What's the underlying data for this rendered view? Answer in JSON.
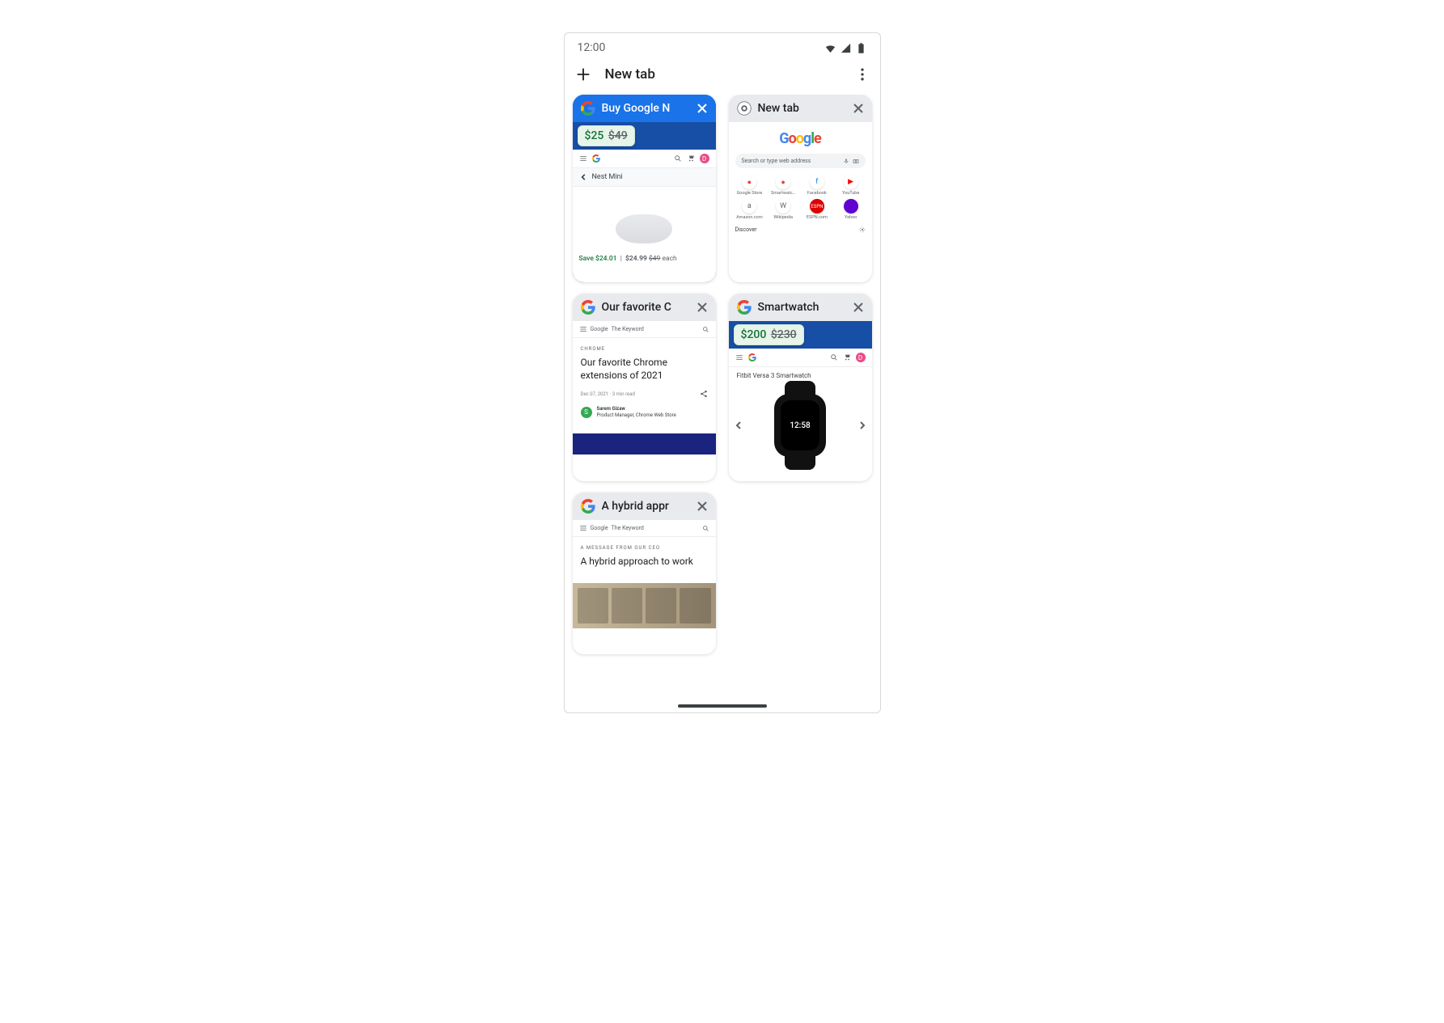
{
  "status": {
    "time": "12:00"
  },
  "toolbar": {
    "new_tab_label": "New tab"
  },
  "tabs": [
    {
      "title": "Buy Google N",
      "selected": true,
      "favicon": "google",
      "price_chip": {
        "current": "$25",
        "old": "$49"
      },
      "store": {
        "back_label": "Nest Mini",
        "save_text": "Save $24.01",
        "price_text": "$24.99",
        "old_price": "$49",
        "suffix": "each"
      }
    },
    {
      "title": "New tab",
      "favicon": "chrome",
      "ntp": {
        "search_placeholder": "Search or type web address",
        "sites": [
          "Google Store",
          "Smartwatc…",
          "Facebook",
          "YouTube",
          "Amazon.com",
          "Wikipedia",
          "ESPN.com",
          "Yahoo"
        ],
        "discover_label": "Discover"
      }
    },
    {
      "title": "Our favorite C",
      "favicon": "google",
      "article": {
        "brand_a": "Google",
        "brand_b": "The Keyword",
        "kicker": "CHROME",
        "headline": "Our favorite Chrome extensions of 2021",
        "meta": "Dec 07, 2021  ·  3 min read",
        "author_name": "Sarem Gizaw",
        "author_title": "Product Manager, Chrome Web Store"
      }
    },
    {
      "title": "Smartwatch",
      "favicon": "google",
      "price_chip": {
        "current": "$200",
        "old": "$230"
      },
      "smartwatch": {
        "product_title": "Fitbit Versa 3 Smartwatch",
        "watch_time": "12:58"
      }
    },
    {
      "title": "A hybrid appr",
      "favicon": "google",
      "article2": {
        "brand_a": "Google",
        "brand_b": "The Keyword",
        "kicker": "A MESSAGE FROM OUR CEO",
        "headline": "A hybrid approach to work"
      }
    }
  ]
}
